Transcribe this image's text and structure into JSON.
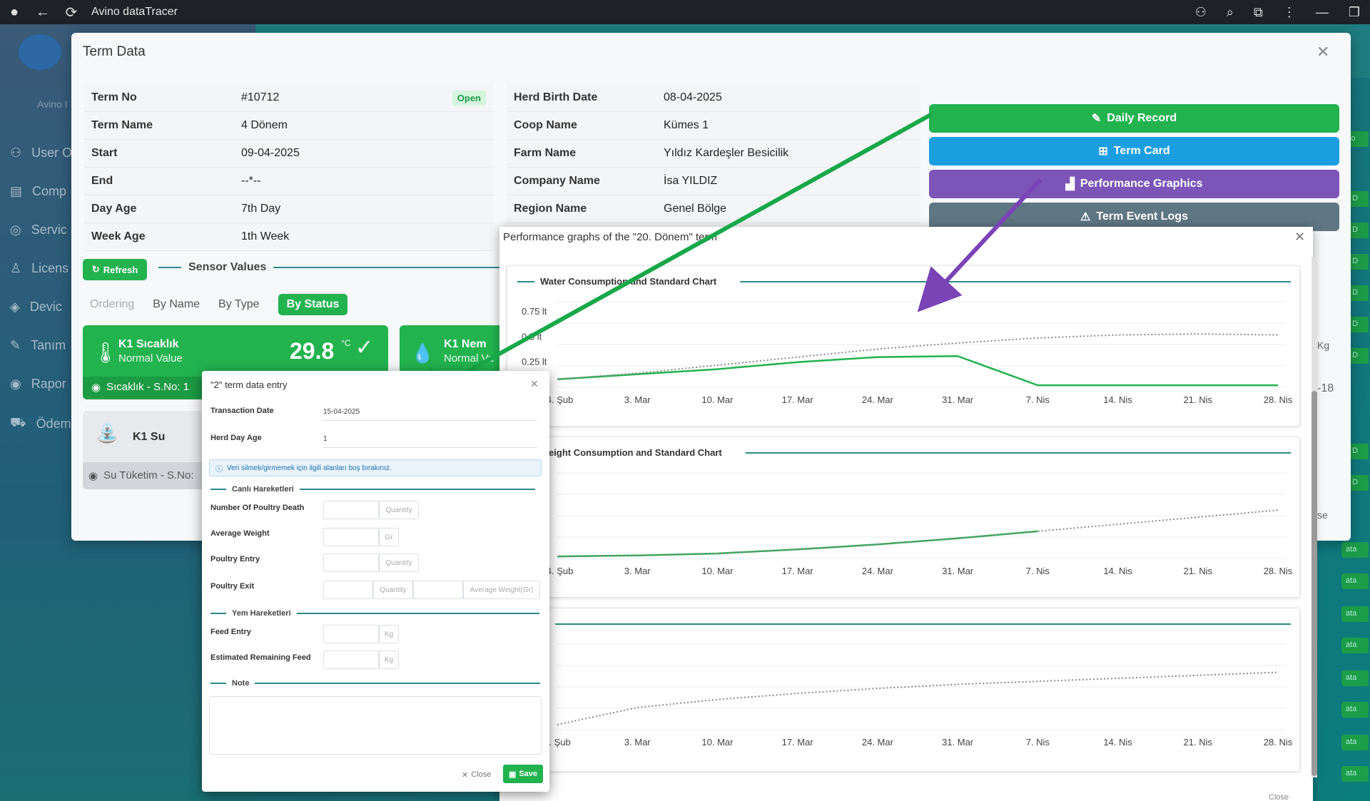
{
  "titlebar": {
    "title": "Avino dataTracer"
  },
  "background": {
    "menu": [
      "User O",
      "Comp",
      "Servic",
      "Licens",
      "Devic",
      "Tanım",
      "Rapor",
      "Ödem"
    ],
    "tags": [
      "Bo",
      "n D",
      "n D",
      "n D",
      "n D",
      "n D",
      "n D",
      "n D",
      "n D",
      "ata",
      "ata",
      "ata",
      "ata",
      "ata",
      "ata",
      "ata",
      "ata"
    ],
    "side_label": "Avino I",
    "right_kg": "Kg",
    "right_num": "-18",
    "right_se": "se"
  },
  "modal": {
    "title": "Term Data",
    "left_info": [
      {
        "k": "Term No",
        "v": "#10712"
      },
      {
        "k": "Term Name",
        "v": "4 Dönem"
      },
      {
        "k": "Start",
        "v": "09-04-2025"
      },
      {
        "k": "End",
        "v": "--*--"
      },
      {
        "k": "Day Age",
        "v": "7th Day"
      },
      {
        "k": "Week Age",
        "v": "1th Week"
      }
    ],
    "status_badge": "Open",
    "right_info": [
      {
        "k": "Herd Birth Date",
        "v": "08-04-2025"
      },
      {
        "k": "Coop Name",
        "v": "Kümes 1"
      },
      {
        "k": "Farm Name",
        "v": "Yıldız Kardeşler Besicilik"
      },
      {
        "k": "Company Name",
        "v": "İsa YILDIZ"
      },
      {
        "k": "Region Name",
        "v": "Genel Bölge"
      }
    ],
    "buttons": {
      "daily_record": "Daily Record",
      "term_card": "Term Card",
      "performance_graphics": "Performance Graphics",
      "term_event_logs": "Term Event Logs"
    },
    "colors": {
      "green": "#22b34f",
      "blue": "#1a9ee0",
      "purple": "#7b55b8",
      "gray": "#5f7683"
    }
  },
  "sensors": {
    "refresh": "Refresh",
    "title": "Sensor Values",
    "ordering_label": "Ordering",
    "by_name": "By Name",
    "by_type": "By Type",
    "by_status": "By Status",
    "card1": {
      "name": "K1 Sıcaklık",
      "status": "Normal Value",
      "value": "29.8",
      "unit": "°C",
      "footer": "Sıcaklık - S.No: 1"
    },
    "card2": {
      "name": "K1 Nem",
      "status": "Normal Va"
    },
    "card3": {
      "name": "K1 Su",
      "footer": "Su Tüketim - S.No:"
    }
  },
  "perf": {
    "title": "Performance graphs of the \"20. Dönem\" term",
    "close_label": "Close",
    "x_ticks": [
      "24. Şub",
      "3. Mar",
      "10. Mar",
      "17. Mar",
      "24. Mar",
      "31. Mar",
      "7. Nis",
      "14. Nis",
      "21. Nis",
      "28. Nis"
    ],
    "x_ticks_c3_first": "4. Şub",
    "chart1_legend": "Water Consumption and Standard Chart",
    "chart1_y_ticks": [
      "0.75 lt",
      "0.5 lt",
      "0.25 lt"
    ],
    "chart2_legend": "Weight Consumption and Standard Chart",
    "chart3_legend": "t"
  },
  "chart_data": [
    {
      "type": "line",
      "title": "Water Consumption and Standard Chart",
      "ylabel": "lt",
      "ylim": [
        0,
        0.85
      ],
      "x": [
        "24. Şub",
        "3. Mar",
        "10. Mar",
        "17. Mar",
        "24. Mar",
        "31. Mar",
        "7. Nis",
        "14. Nis",
        "21. Nis",
        "28. Nis"
      ],
      "series": [
        {
          "name": "actual",
          "values": [
            0.08,
            0.13,
            0.18,
            0.25,
            0.3,
            0.31,
            0.02,
            0.02,
            0.02,
            0.02
          ]
        },
        {
          "name": "standard",
          "values": [
            0.08,
            0.14,
            0.22,
            0.3,
            0.38,
            0.44,
            0.49,
            0.52,
            0.53,
            0.52
          ]
        }
      ]
    },
    {
      "type": "line",
      "title": "Weight Consumption and Standard Chart",
      "x": [
        "24. Şub",
        "3. Mar",
        "10. Mar",
        "17. Mar",
        "24. Mar",
        "31. Mar",
        "7. Nis",
        "14. Nis",
        "21. Nis",
        "28. Nis"
      ],
      "series": [
        {
          "name": "actual",
          "values": [
            0.02,
            0.03,
            0.05,
            0.09,
            0.14,
            0.2,
            0.27
          ]
        },
        {
          "name": "standard",
          "values": [
            0.02,
            0.03,
            0.05,
            0.09,
            0.14,
            0.2,
            0.27,
            0.34,
            0.41,
            0.48
          ]
        }
      ]
    },
    {
      "type": "line",
      "title": "",
      "x": [
        "4. Şub",
        "3. Mar",
        "10. Mar",
        "17. Mar",
        "24. Mar",
        "31. Mar",
        "7. Nis",
        "14. Nis",
        "21. Nis",
        "28. Nis"
      ],
      "series": [
        {
          "name": "standard",
          "values": [
            0.05,
            0.22,
            0.3,
            0.36,
            0.41,
            0.45,
            0.48,
            0.51,
            0.54,
            0.57
          ]
        }
      ]
    }
  ],
  "entry": {
    "title": "\"2\" term data entry",
    "transaction_date_label": "Transaction Date",
    "transaction_date": "15-04-2025",
    "herd_day_age_label": "Herd Day Age",
    "herd_day_age": "1",
    "info": "Veri silmek/girmemek için ilgili alanları boş bırakınız.",
    "sec_canli": "Canlı Hareketleri",
    "poultry_death": "Number Of Poultry Death",
    "avg_weight": "Average Weight",
    "poultry_entry": "Poultry Entry",
    "poultry_exit": "Poultry Exit",
    "sec_yem": "Yem Hareketleri",
    "feed_entry": "Feed Entry",
    "remaining_feed": "Estimated Remaining Feed",
    "sec_note": "Note",
    "ph_quantity": "Quantity",
    "ph_gr": "Gr",
    "ph_kg": "Kg",
    "ph_avg_weight_gr": "Average Weight(Gr)",
    "close": "Close",
    "save": "Save"
  }
}
